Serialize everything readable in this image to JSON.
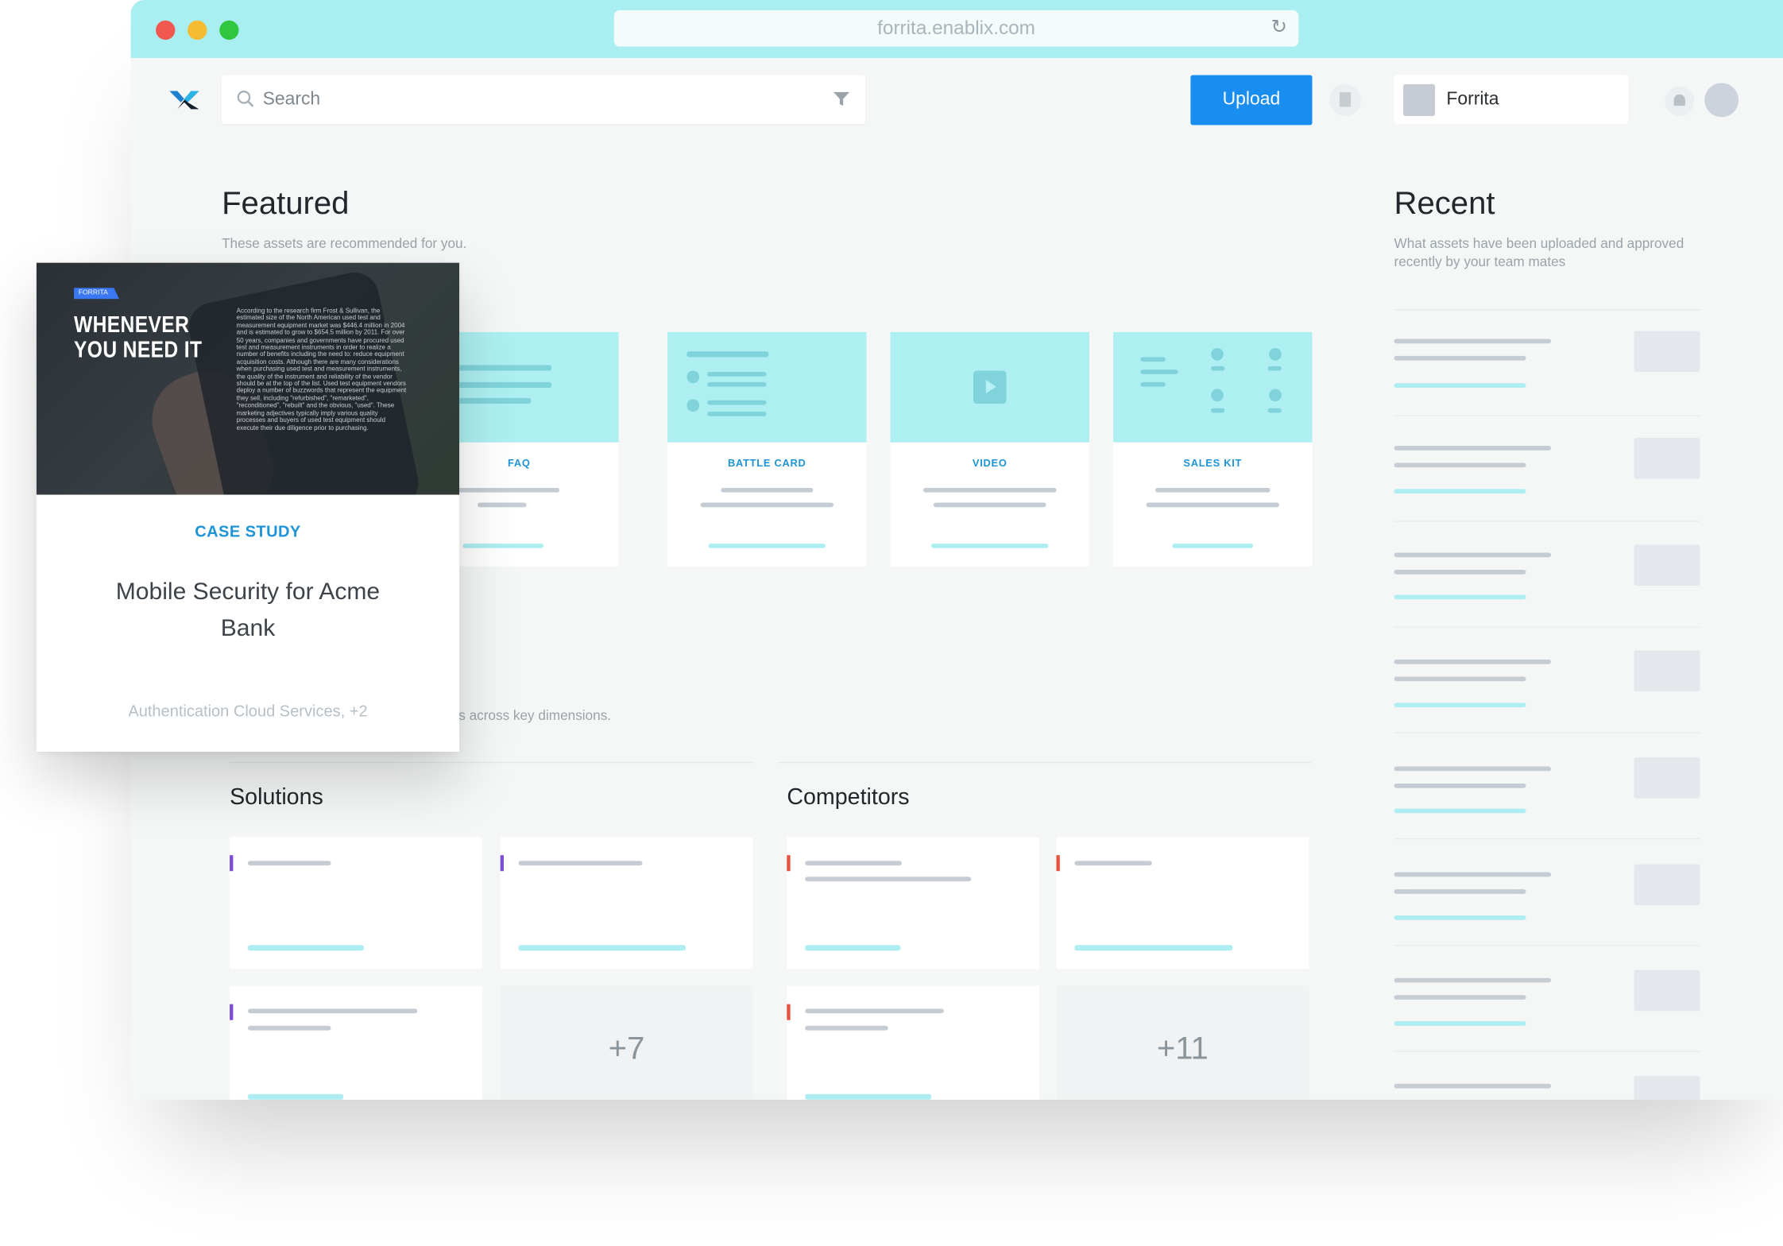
{
  "browser": {
    "url": "forrita.enablix.com"
  },
  "toolbar": {
    "search_placeholder": "Search",
    "upload_label": "Upload",
    "workspace_name": "Forrita"
  },
  "featured": {
    "title": "Featured",
    "subtitle": "These assets are recommended for you.",
    "cards": [
      {
        "type": "FAQ"
      },
      {
        "type": "BATTLE CARD"
      },
      {
        "type": "VIDEO"
      },
      {
        "type": "SALES KIT"
      }
    ]
  },
  "explore": {
    "subtitle_fragment": "ts across key dimensions.",
    "solutions": {
      "title": "Solutions",
      "more_count": "+7",
      "accent": "#7b4dd6"
    },
    "competitors": {
      "title": "Competitors",
      "more_count": "+11",
      "accent": "#e8513f"
    }
  },
  "recent": {
    "title": "Recent",
    "subtitle": "What assets have been uploaded and approved recently by your team mates"
  },
  "case_card": {
    "badge": "FORRITA",
    "hero_title": "WHENEVER\nYOU NEED IT",
    "hero_text": "According to the research firm Frost & Sullivan, the estimated size of the North American used test and measurement equipment market was $446.4 million in 2004 and is estimated to grow to $654.5 million by 2011. For over 50 years, companies and governments have procured used test and measurement instruments in order to realize a number of benefits including the need to: reduce equipment acquisition costs. Although there are many considerations when purchasing used test and measurement instruments, the quality of the instrument and reliability of the vendor should be at the top of the list. Used test equipment vendors deploy a number of buzzwords that represent the equipment they sell, including \"refurbished\", \"remarketed\", \"reconditioned\", \"rebuilt\" and the obvious, \"used\". These marketing adjectives typically imply various quality processes and buyers of used test equipment should execute their due diligence prior to purchasing.",
    "type": "CASE STUDY",
    "title": "Mobile Security for Acme Bank",
    "tags": "Authentication Cloud Services, +2"
  },
  "colors": {
    "accent": "#1a8ef0",
    "titlebar": "#a9eef0",
    "teal": "#aef0f2"
  },
  "icons": [
    "search-icon",
    "filter-icon",
    "reload-icon",
    "document-icon",
    "bell-icon",
    "play-icon",
    "enablix-logo"
  ]
}
